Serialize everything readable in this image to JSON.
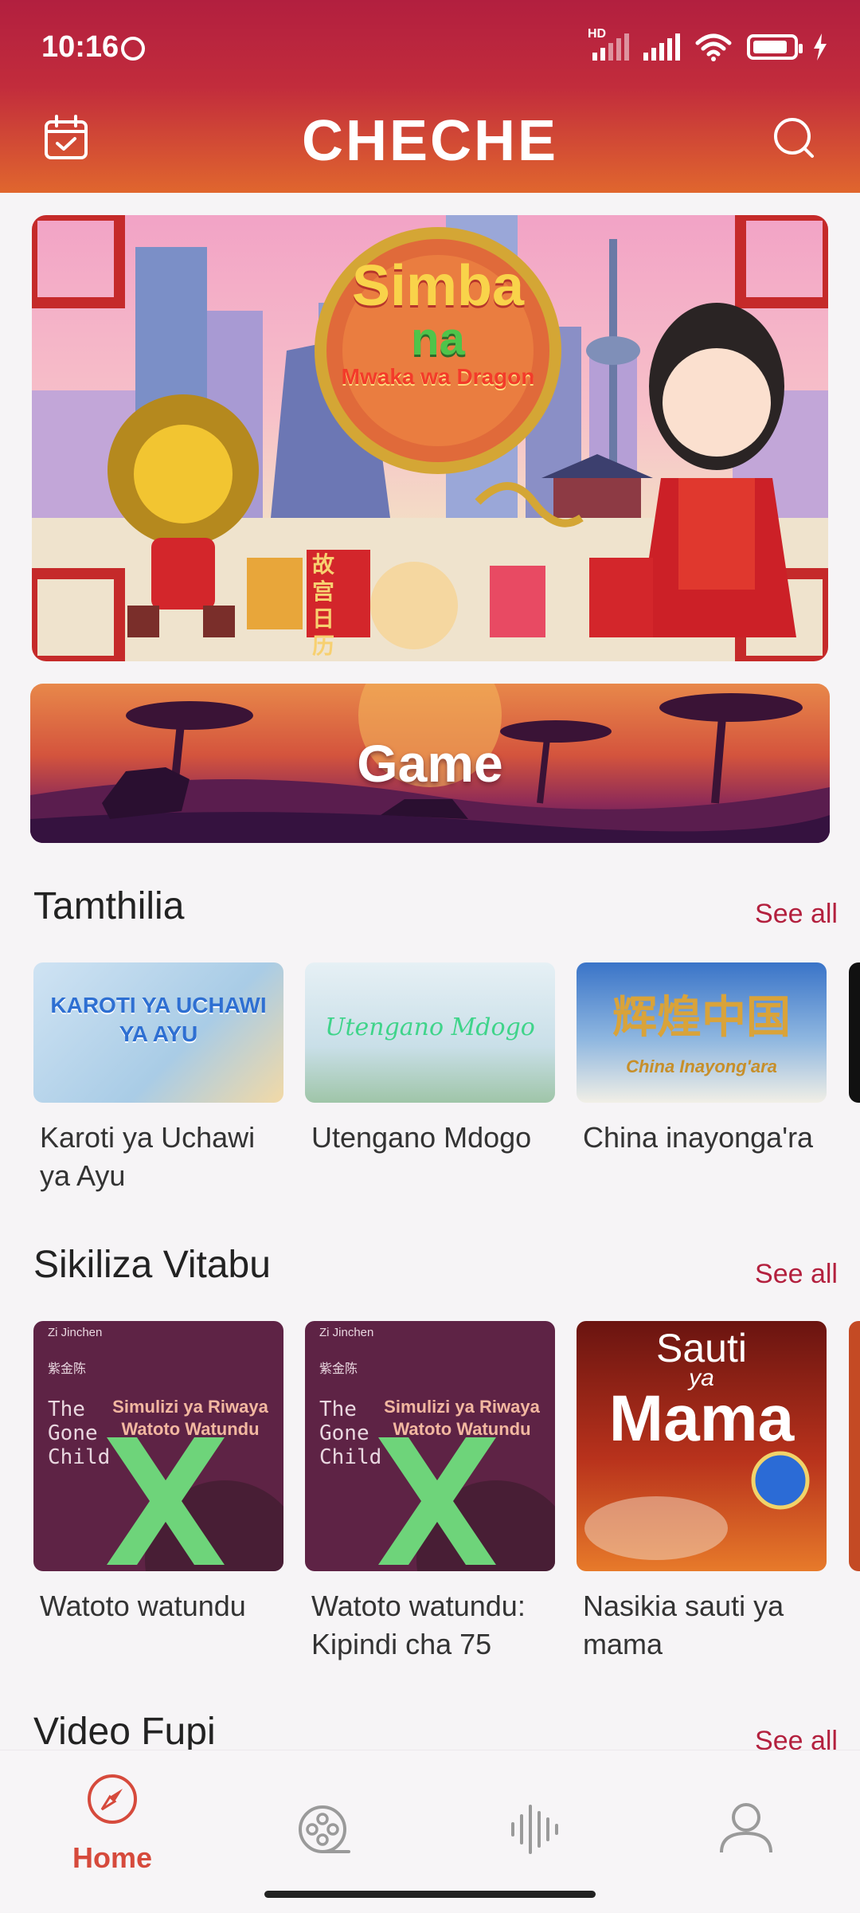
{
  "status": {
    "time": "10:16",
    "hd": "HD"
  },
  "header": {
    "title": "CHECHE"
  },
  "banner": {
    "title_line1": "Simba",
    "title_line2": "na",
    "title_line3": "Mwaka wa Dragon",
    "sign_text": "故宫日历"
  },
  "game": {
    "label": "Game"
  },
  "sections": [
    {
      "title": "Tamthilia",
      "see_all": "See all",
      "items": [
        {
          "label": "Karoti ya Uchawi ya Ayu",
          "thumb_text": "KAROTI YA UCHAWI YA AYU"
        },
        {
          "label": "Utengano Mdogo",
          "thumb_text": "Utengano Mdogo"
        },
        {
          "label": "China inayonga'ra",
          "thumb_text": "辉煌中国",
          "thumb_sub": "China Inayong'ara"
        }
      ]
    },
    {
      "title": "Sikiliza Vitabu",
      "see_all": "See all",
      "items": [
        {
          "label": "Watoto watundu",
          "author_en": "Zi Jinchen",
          "author_zh": "紫金陈",
          "book_en": "The Gone Child",
          "book_sw": "Simulizi ya Riwaya Watoto Watundu"
        },
        {
          "label": "Watoto watundu: Kipindi cha 75",
          "author_en": "Zi Jinchen",
          "author_zh": "紫金陈",
          "book_en": "The Gone Child",
          "book_sw": "Simulizi ya Riwaya Watoto Watundu"
        },
        {
          "label": "Nasikia sauti ya mama",
          "cover_top": "Sauti",
          "cover_mid": "ya",
          "cover_big": "Mama"
        }
      ]
    },
    {
      "title": "Video Fupi",
      "see_all": "See all"
    }
  ],
  "nav": {
    "home_label": "Home"
  },
  "colors": {
    "accent": "#b3203e",
    "header_top": "#b21f3f",
    "header_bottom": "#e0662e",
    "nav_active": "#d64a3c"
  }
}
